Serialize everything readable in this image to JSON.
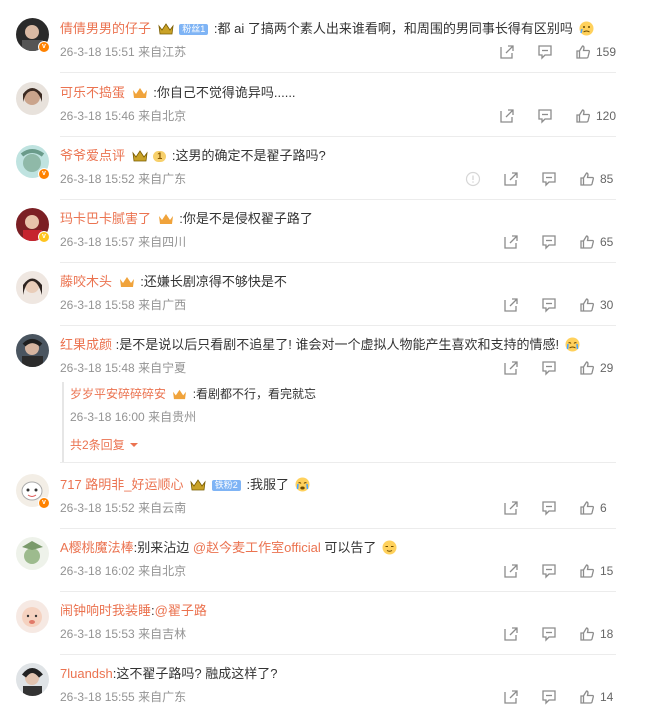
{
  "comments": [
    {
      "user": "倩倩男男的仔子",
      "badge": "粉丝1",
      "text": ":都 ai 了搞两个素人出来谁看啊，和周围的男同事长得有区别吗",
      "time": "26-3-18 15:51",
      "location": "来自江苏",
      "likes": "159"
    },
    {
      "user": "可乐不捣蛋",
      "text": ":你自己不觉得诡异吗......",
      "time": "26-3-18 15:46",
      "location": "来自北京",
      "likes": "120"
    },
    {
      "user": "爷爷爱点评",
      "level": "1",
      "text": ":这男的确定不是翟子路吗?",
      "time": "26-3-18 15:52",
      "location": "来自广东",
      "likes": "85"
    },
    {
      "user": "玛卡巴卡腻害了",
      "text": ":你是不是侵权翟子路了",
      "time": "26-3-18 15:57",
      "location": "来自四川",
      "likes": "65"
    },
    {
      "user": "藤咬木头",
      "text": ":还嫌长剧凉得不够快是不",
      "time": "26-3-18 15:58",
      "location": "来自广西",
      "likes": "30"
    },
    {
      "user": "红果成颜",
      "text": ":是不是说以后只看剧不追星了! 谁会对一个虚拟人物能产生喜欢和支持的情感!",
      "time": "26-3-18 15:48",
      "location": "来自宁夏",
      "likes": "29",
      "reply": {
        "user": "岁岁平安碎碎碎安",
        "text": ":看剧都不行，看完就忘",
        "time": "26-3-18 16:00",
        "location": "来自贵州",
        "more": "共2条回复"
      }
    },
    {
      "user": "717 路明非_好运顺心",
      "badge": "铁粉2",
      "text": ":我服了",
      "time": "26-3-18 15:52",
      "location": "来自云南",
      "likes": "6"
    },
    {
      "user": "A樱桃魔法棒",
      "text": ":别来沾边 ",
      "mention": "@赵今麦工作室official",
      "text2": " 可以告了",
      "time": "26-3-18 16:02",
      "location": "来自北京",
      "likes": "15"
    },
    {
      "user": "闹钟响时我装睡",
      "text": ":",
      "mention": "@翟子路",
      "time": "26-3-18 15:53",
      "location": "来自吉林",
      "likes": "18"
    },
    {
      "user": "7luandsh",
      "text": ":这不翟子路吗? 融成这样了?",
      "time": "26-3-18 15:55",
      "location": "来自广东",
      "likes": "14"
    }
  ]
}
